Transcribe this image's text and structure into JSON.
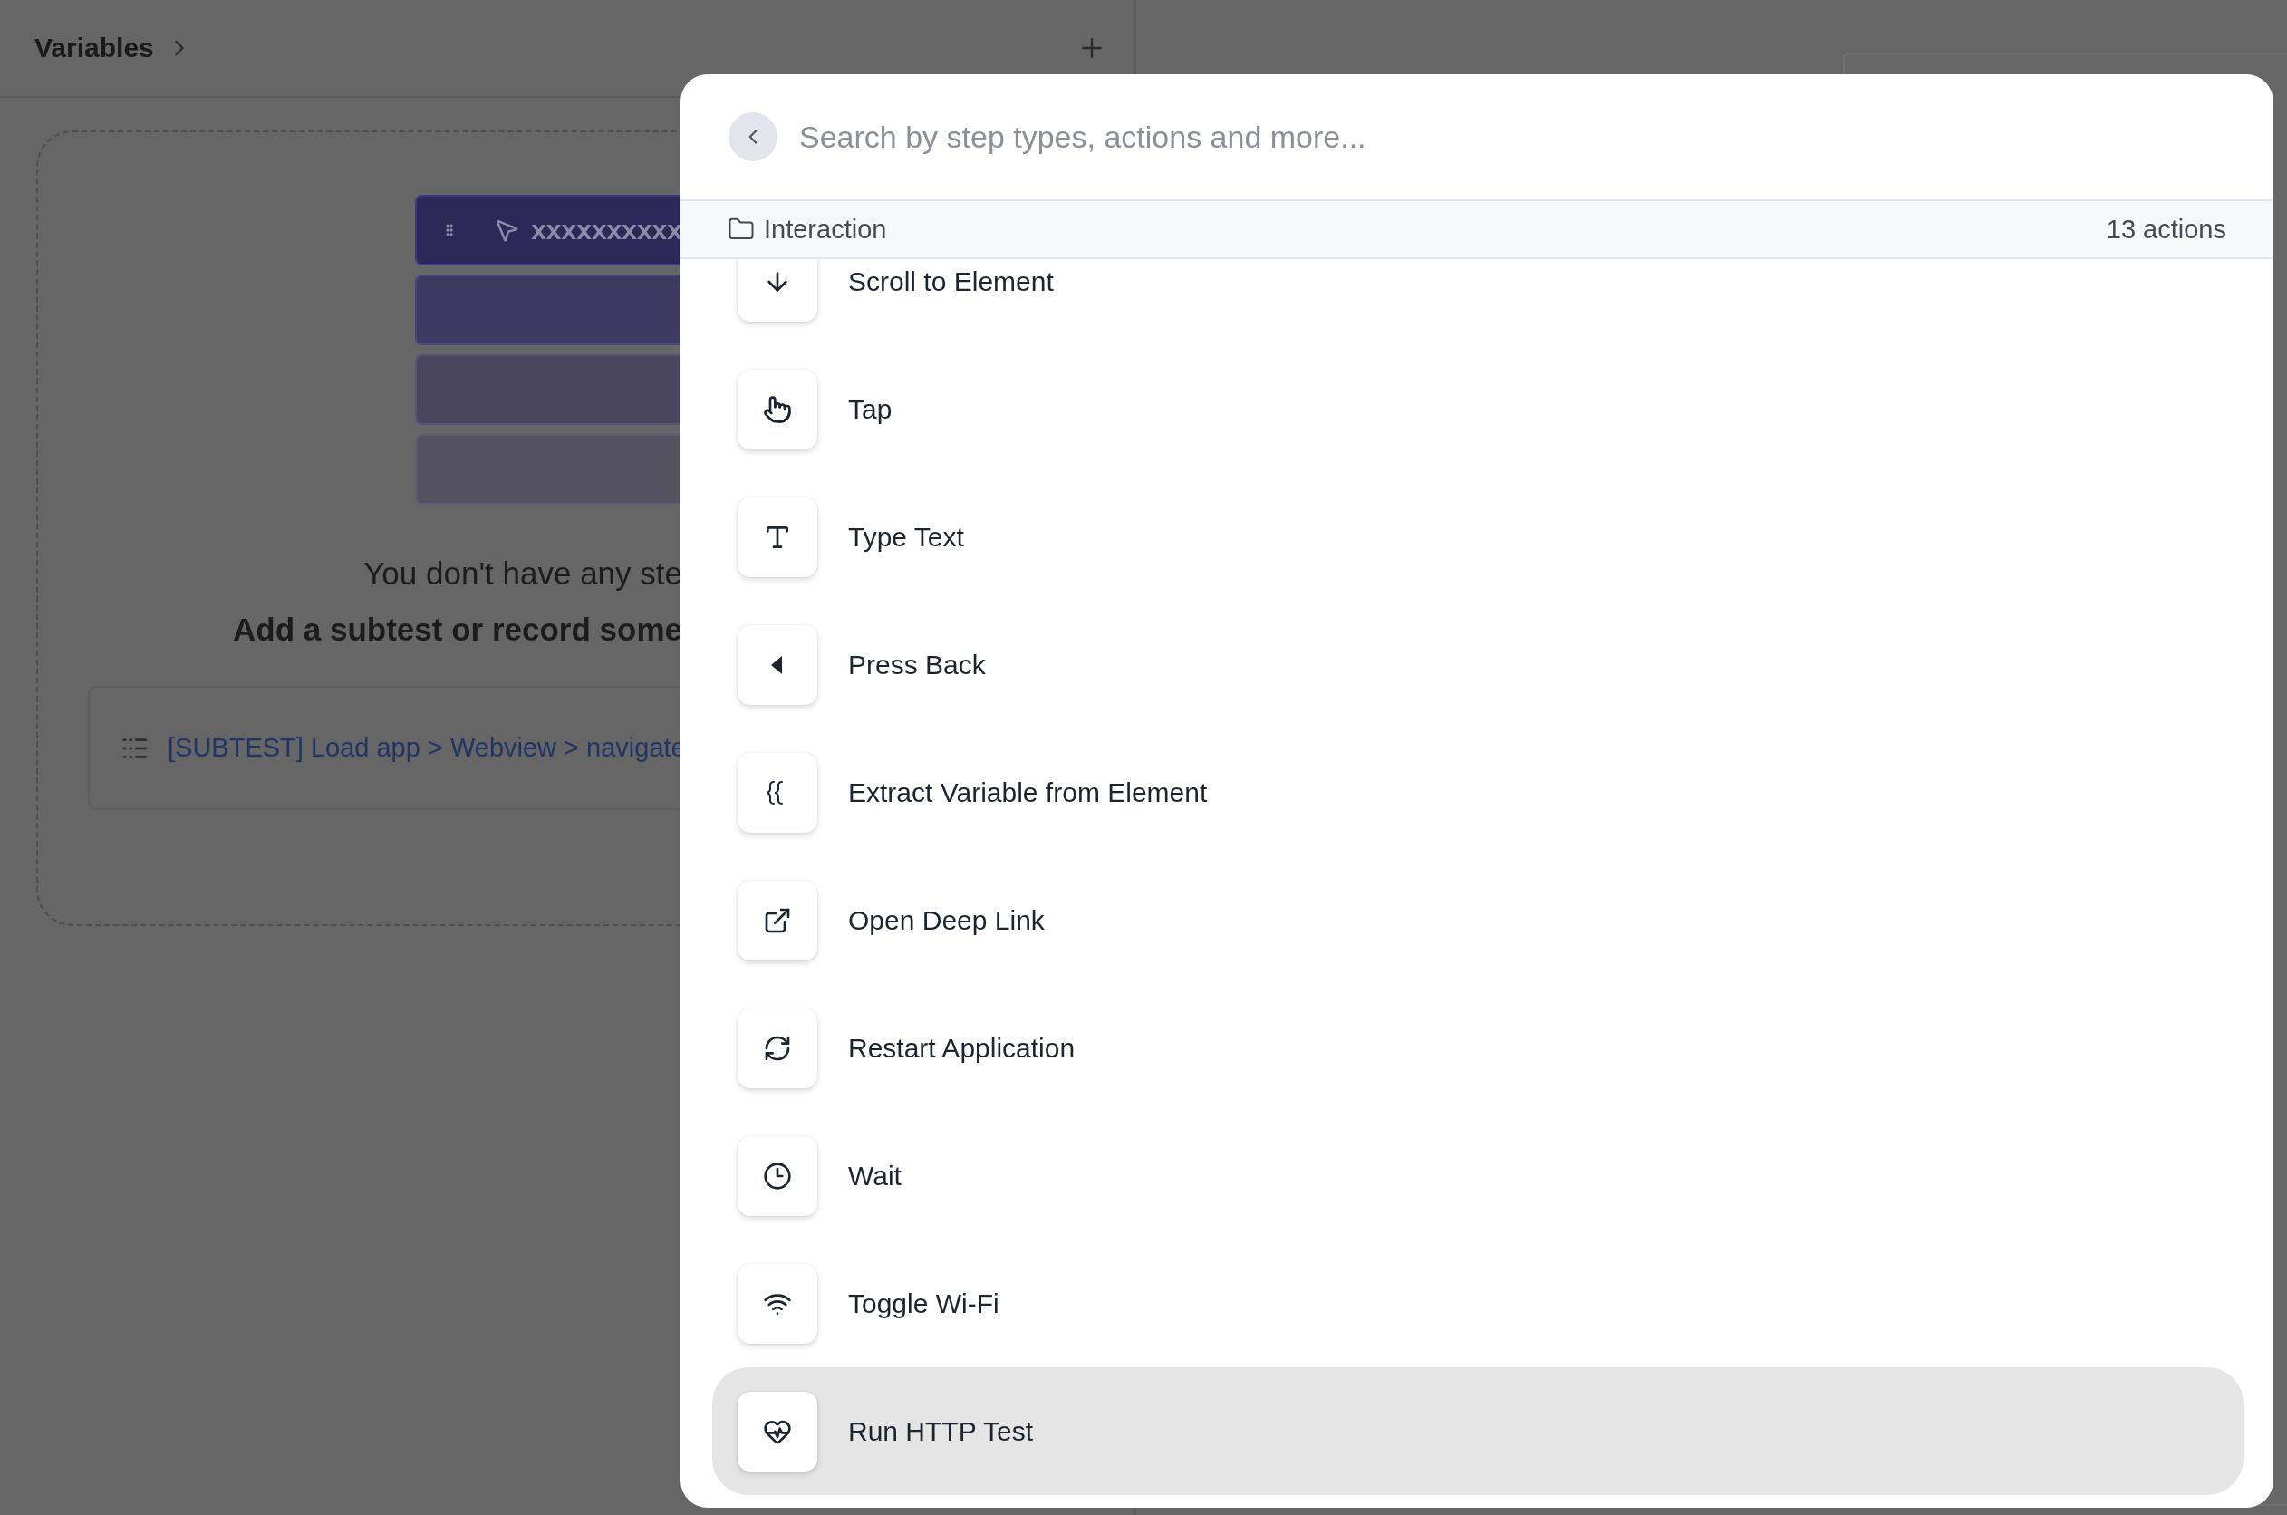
{
  "sidebar": {
    "title": "Variables",
    "steps_preview": {
      "label": "xxxxxxxxxx"
    },
    "empty_message": "You don't have any ste",
    "empty_hint": "Add a subtest or record some",
    "subtest_link": "[SUBTEST] Load app > Webview > navigate"
  },
  "search": {
    "placeholder": "Search by step types, actions and more..."
  },
  "category": {
    "label": "Interaction",
    "count": "13 actions"
  },
  "actions": [
    {
      "label": "Scroll to Element",
      "selected": false
    },
    {
      "label": "Tap",
      "selected": false
    },
    {
      "label": "Type Text",
      "selected": false
    },
    {
      "label": "Press Back",
      "selected": false
    },
    {
      "label": "Extract Variable from Element",
      "selected": false
    },
    {
      "label": "Open Deep Link",
      "selected": false
    },
    {
      "label": "Restart Application",
      "selected": false
    },
    {
      "label": "Wait",
      "selected": false
    },
    {
      "label": "Toggle Wi-Fi",
      "selected": false
    },
    {
      "label": "Run HTTP Test",
      "selected": true
    }
  ]
}
